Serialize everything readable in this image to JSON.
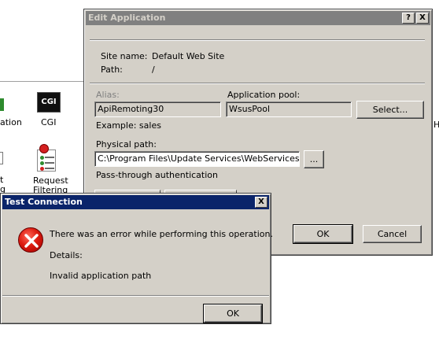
{
  "background": {
    "fragment_label": "ation",
    "cgi_icon_text": "CGI",
    "cgi_label": "CGI",
    "fragment_t": "t",
    "fragment_g": "g",
    "request_filtering_label_1": "Request",
    "request_filtering_label_2": "Filtering",
    "right_edge_char": "H"
  },
  "edit_dialog": {
    "title": "Edit Application",
    "help_button": "?",
    "close_button": "X",
    "site_name_label": "Site name:",
    "site_name_value": "Default Web Site",
    "path_label": "Path:",
    "path_value": "/",
    "alias_label": "Alias:",
    "alias_value": "ApiRemoting30",
    "app_pool_label": "Application pool:",
    "app_pool_value": "WsusPool",
    "select_button": "Select...",
    "example_text": "Example: sales",
    "physical_path_label": "Physical path:",
    "physical_path_value": "C:\\Program Files\\Update Services\\WebServices\\apire",
    "browse_button": "...",
    "pass_through_label": "Pass-through authentication",
    "ok_button": "OK",
    "cancel_button": "Cancel"
  },
  "test_dialog": {
    "title": "Test Connection",
    "close_button": "X",
    "message": "There was an error while performing this operation.",
    "details_label": "Details:",
    "details_text": "Invalid application path",
    "ok_button": "OK"
  },
  "colors": {
    "dialog_face": "#d4d0c8",
    "active_title": "#0a246a",
    "inactive_title": "#808080",
    "error_red": "#dd1c10"
  }
}
